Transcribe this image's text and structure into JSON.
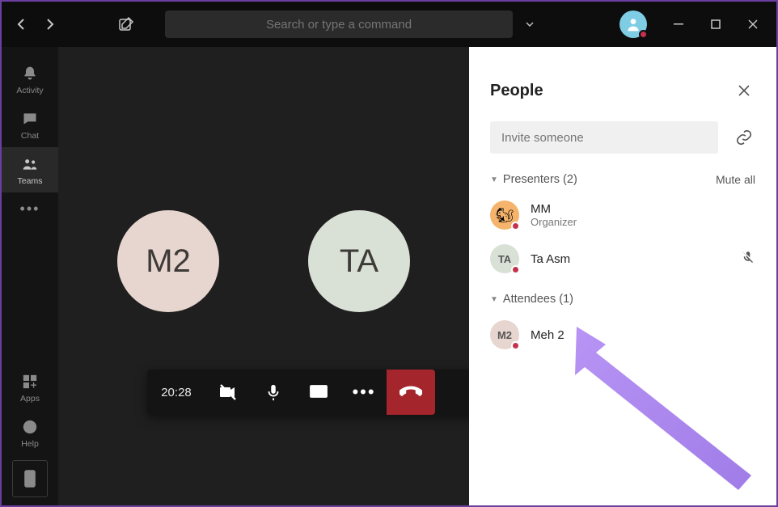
{
  "titlebar": {
    "search_placeholder": "Search or type a command"
  },
  "rail": {
    "activity": "Activity",
    "chat": "Chat",
    "teams": "Teams",
    "apps": "Apps",
    "help": "Help"
  },
  "stage": {
    "timer": "20:28",
    "participants": [
      {
        "initials": "M2",
        "name": "Meh 2",
        "muted": false
      },
      {
        "initials": "TA",
        "name": "Ta Asm",
        "muted": true
      }
    ]
  },
  "panel": {
    "title": "People",
    "invite_placeholder": "Invite someone",
    "mute_all": "Mute all",
    "presenters_label": "Presenters (2)",
    "attendees_label": "Attendees (1)",
    "presenters": [
      {
        "initials": "MM",
        "name": "MM",
        "role": "Organizer",
        "avatar": "mm",
        "muted": false
      },
      {
        "initials": "TA",
        "name": "Ta Asm",
        "role": "",
        "avatar": "ta",
        "muted": true
      }
    ],
    "attendees": [
      {
        "initials": "M2",
        "name": "Meh 2",
        "role": "",
        "avatar": "m2",
        "muted": false
      }
    ]
  }
}
